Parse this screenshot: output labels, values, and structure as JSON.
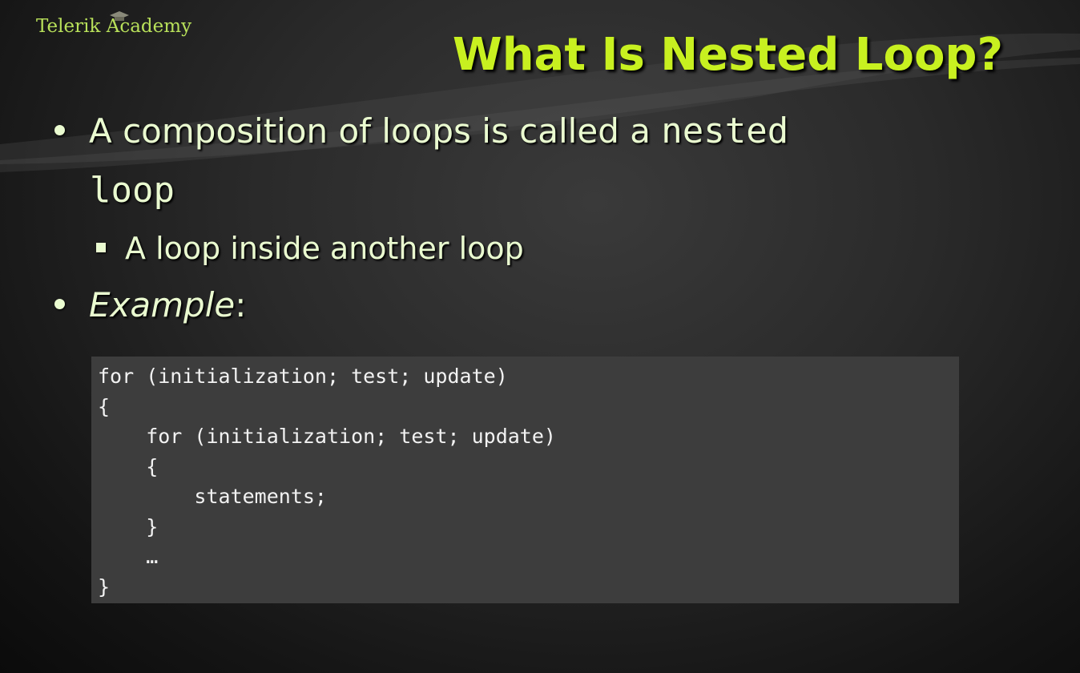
{
  "slide": {
    "logo": "Telerik Academy",
    "title": "What Is Nested Loop?",
    "bullets": {
      "b1_text": "A composition of loops is called a ",
      "b1_code1": "nested",
      "b1_code2": "loop",
      "b1_sub": "A loop inside another loop",
      "b2_italic": "Example",
      "b2_rest": ":"
    },
    "code_lines": [
      "for (initialization; test; update)",
      "{",
      "    for (initialization; test; update)",
      "    {",
      "        statements;",
      "    }",
      "    …",
      "}"
    ]
  }
}
